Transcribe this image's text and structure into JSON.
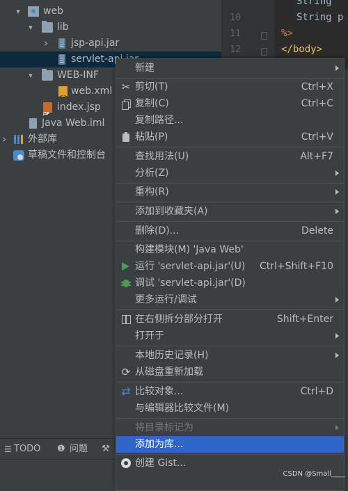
{
  "tree": {
    "items": [
      {
        "label": "web",
        "icon": "web-folder-icon",
        "arrow": "▾"
      },
      {
        "label": "lib",
        "icon": "folder-icon",
        "arrow": "▾"
      },
      {
        "label": "jsp-api.jar",
        "icon": "jar-icon",
        "arrow": "›"
      },
      {
        "label": "servlet-api.jar",
        "icon": "jar-icon",
        "arrow": ""
      },
      {
        "label": "WEB-INF",
        "icon": "folder-icon",
        "arrow": "▾"
      },
      {
        "label": "web.xml",
        "icon": "xml-file-icon",
        "arrow": ""
      },
      {
        "label": "index.jsp",
        "icon": "jsp-file-icon",
        "arrow": ""
      },
      {
        "label": "Java Web.iml",
        "icon": "module-file-icon",
        "arrow": ""
      },
      {
        "label": "外部库",
        "icon": "external-libraries-icon",
        "arrow": "›"
      },
      {
        "label": "草稿文件和控制台",
        "icon": "scratches-icon",
        "arrow": ""
      }
    ]
  },
  "editor": {
    "lines": [
      {
        "num": "",
        "code": "String "
      },
      {
        "num": "10",
        "code": "String p"
      },
      {
        "num": "11",
        "code": "%>"
      },
      {
        "num": "12",
        "code": "</body>"
      }
    ]
  },
  "bottombar": {
    "todo": "TODO",
    "problems": "问题"
  },
  "menu": {
    "items": [
      {
        "label": "新建",
        "shortcut": "",
        "submenu": true,
        "icon": ""
      },
      {
        "label": "剪切(T)",
        "shortcut": "Ctrl+X",
        "submenu": false,
        "icon": "cut-icon"
      },
      {
        "label": "复制(C)",
        "shortcut": "Ctrl+C",
        "submenu": false,
        "icon": "copy-icon"
      },
      {
        "label": "复制路径...",
        "shortcut": "",
        "submenu": false,
        "icon": ""
      },
      {
        "label": "粘贴(P)",
        "shortcut": "Ctrl+V",
        "submenu": false,
        "icon": "paste-icon"
      },
      {
        "label": "查找用法(U)",
        "shortcut": "Alt+F7",
        "submenu": false,
        "icon": ""
      },
      {
        "label": "分析(Z)",
        "shortcut": "",
        "submenu": true,
        "icon": ""
      },
      {
        "label": "重构(R)",
        "shortcut": "",
        "submenu": true,
        "icon": ""
      },
      {
        "label": "添加到收藏夹(A)",
        "shortcut": "",
        "submenu": true,
        "icon": ""
      },
      {
        "label": "删除(D)...",
        "shortcut": "Delete",
        "submenu": false,
        "icon": ""
      },
      {
        "label": "构建模块(M) 'Java Web'",
        "shortcut": "",
        "submenu": false,
        "icon": ""
      },
      {
        "label": "运行 'servlet-api.jar'(U)",
        "shortcut": "Ctrl+Shift+F10",
        "submenu": false,
        "icon": "run-icon"
      },
      {
        "label": "调试 'servlet-api.jar'(D)",
        "shortcut": "",
        "submenu": false,
        "icon": "debug-icon"
      },
      {
        "label": "更多运行/调试",
        "shortcut": "",
        "submenu": true,
        "icon": ""
      },
      {
        "label": "在右侧拆分部分打开",
        "shortcut": "Shift+Enter",
        "submenu": false,
        "icon": "split-icon"
      },
      {
        "label": "打开于",
        "shortcut": "",
        "submenu": true,
        "icon": ""
      },
      {
        "label": "本地历史记录(H)",
        "shortcut": "",
        "submenu": true,
        "icon": ""
      },
      {
        "label": "从磁盘重新加载",
        "shortcut": "",
        "submenu": false,
        "icon": "reload-icon"
      },
      {
        "label": "比较对象...",
        "shortcut": "Ctrl+D",
        "submenu": false,
        "icon": "compare-icon"
      },
      {
        "label": "与编辑器比较文件(M)",
        "shortcut": "",
        "submenu": false,
        "icon": ""
      },
      {
        "label": "将目录标记为",
        "shortcut": "",
        "submenu": true,
        "icon": "",
        "disabled": true
      },
      {
        "label": "添加为库...",
        "shortcut": "",
        "submenu": false,
        "icon": "",
        "hover": true
      },
      {
        "label": "创建 Gist...",
        "shortcut": "",
        "submenu": false,
        "icon": "github-icon"
      }
    ]
  },
  "watermark": "CSDN @Small____"
}
